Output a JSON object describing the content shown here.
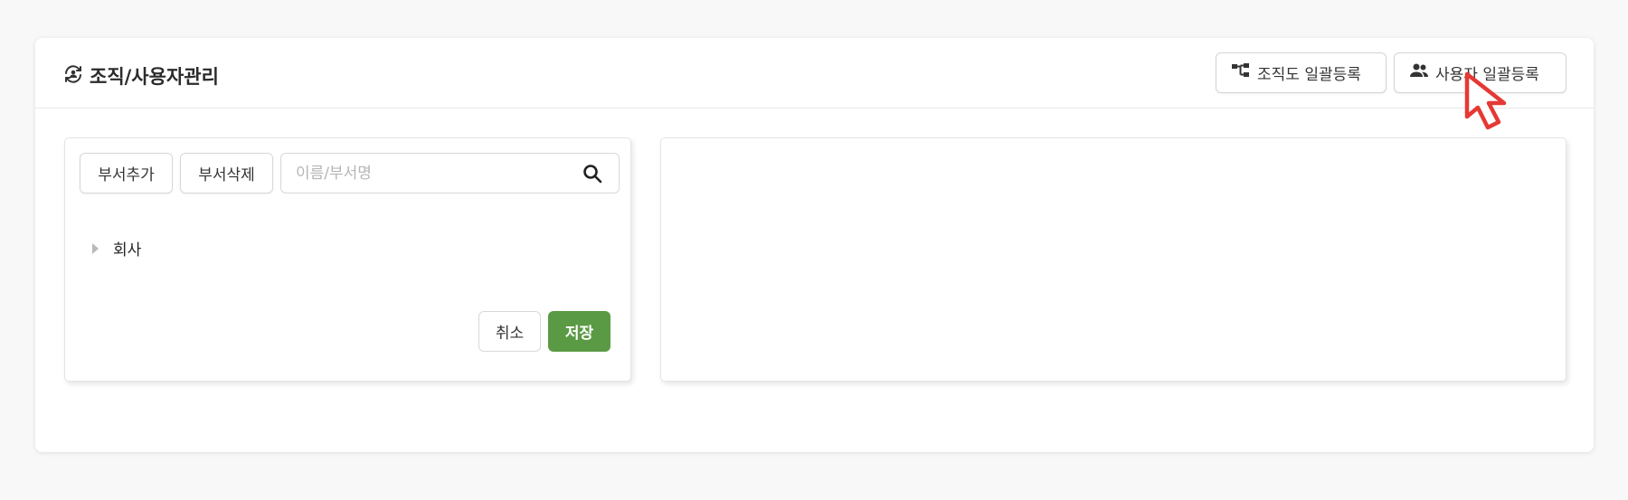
{
  "header": {
    "title": "조직/사용자관리",
    "title_icon": "sync-user-icon",
    "buttons": [
      {
        "label": "조직도 일괄등록",
        "icon": "org-chart-icon"
      },
      {
        "label": "사용자 일괄등록",
        "icon": "users-icon"
      }
    ]
  },
  "left_panel": {
    "add_dept_label": "부서추가",
    "delete_dept_label": "부서삭제",
    "search_placeholder": "이름/부서명",
    "search_value": "",
    "tree": [
      {
        "label": "회사",
        "expanded": false
      }
    ],
    "cancel_label": "취소",
    "save_label": "저장"
  },
  "colors": {
    "save_button": "#5b9a45",
    "cursor": "#e53935"
  }
}
